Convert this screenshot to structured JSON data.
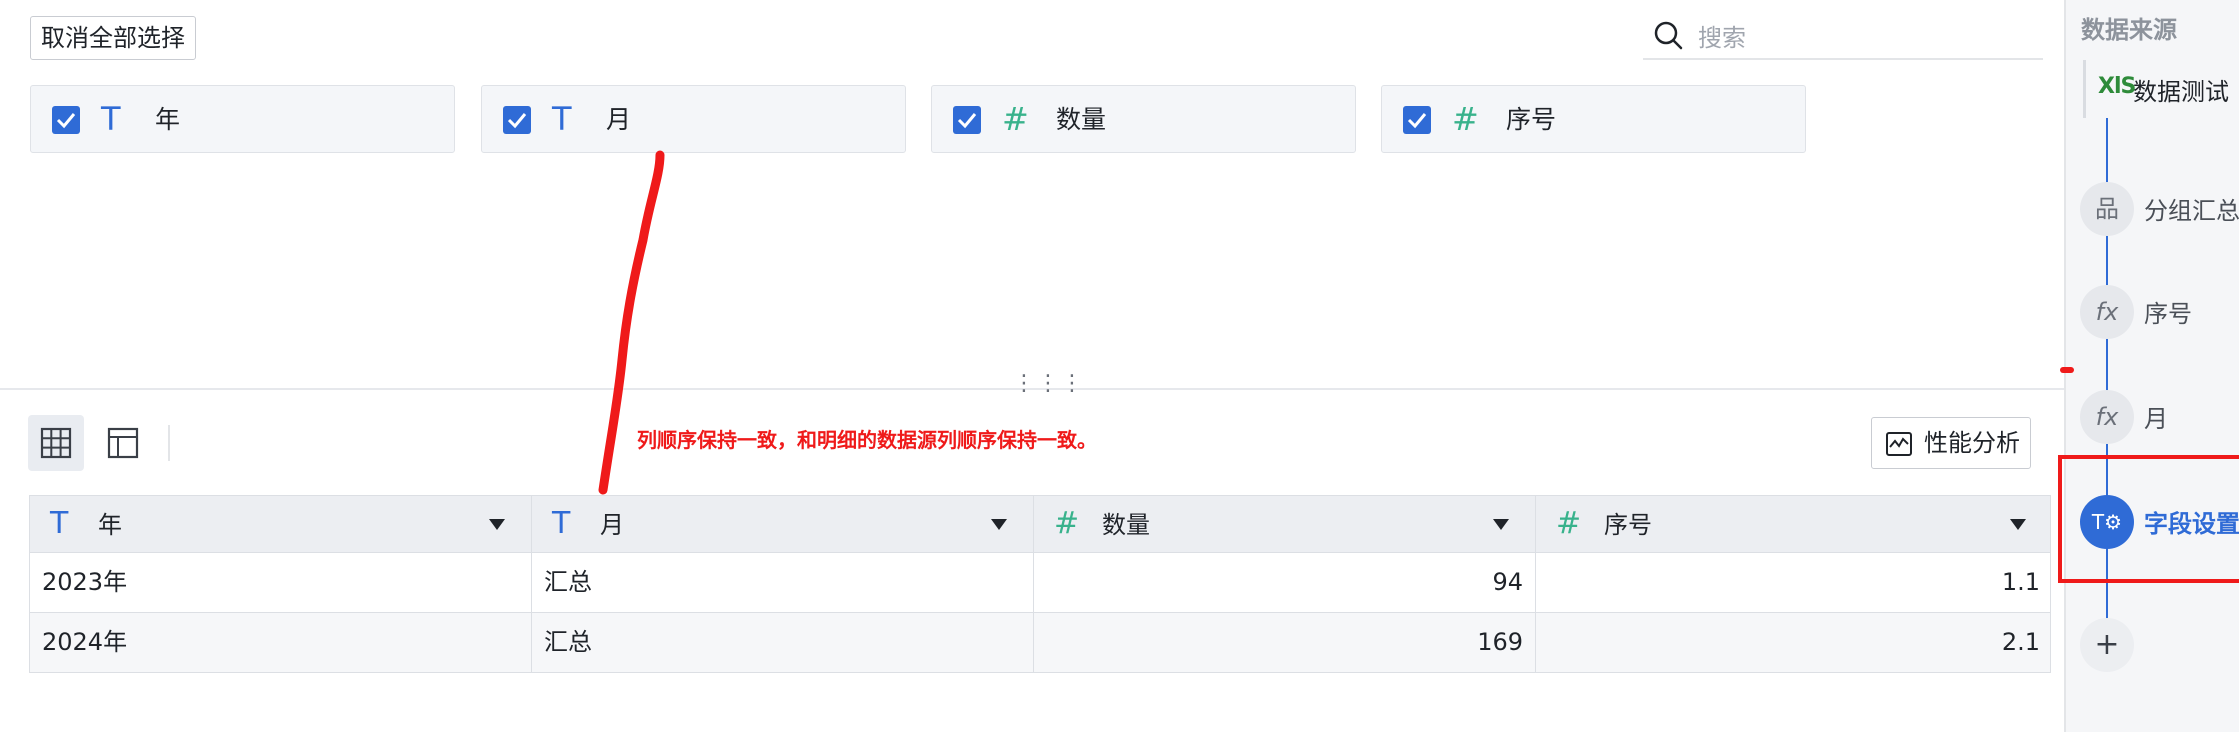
{
  "toolbar": {
    "deselect_all_label": "取消全部选择",
    "search_placeholder": "搜索"
  },
  "field_cards": [
    {
      "type_icon": "T",
      "type": "text",
      "name": "年",
      "checked": true
    },
    {
      "type_icon": "T",
      "type": "text",
      "name": "月",
      "checked": true
    },
    {
      "type_icon": "#",
      "type": "number",
      "name": "数量",
      "checked": true
    },
    {
      "type_icon": "#",
      "type": "number",
      "name": "序号",
      "checked": true
    }
  ],
  "annotation": "列顺序保持一致，和明细的数据源列顺序保持一致。",
  "perf_button_label": "性能分析",
  "table": {
    "headers": [
      {
        "type_icon": "T",
        "name": "年"
      },
      {
        "type_icon": "T",
        "name": "月"
      },
      {
        "type_icon": "#",
        "name": "数量"
      },
      {
        "type_icon": "#",
        "name": "序号"
      }
    ],
    "rows": [
      [
        "2023年",
        "汇总",
        "94",
        "1.1"
      ],
      [
        "2024年",
        "汇总",
        "169",
        "2.1"
      ]
    ]
  },
  "right_panel": {
    "title": "数据来源",
    "source": {
      "badge": "XlS",
      "name": "数据测试"
    },
    "steps": [
      {
        "icon": "品",
        "label": "分组汇总"
      },
      {
        "icon": "fx",
        "label": "序号"
      },
      {
        "icon": "fx",
        "label": "月"
      },
      {
        "icon": "T⚙",
        "label": "字段设置",
        "active": true
      }
    ],
    "add_icon": "+"
  },
  "colors": {
    "accent": "#2f6bd6",
    "number_type": "#38b28c",
    "annotation_red": "#ef1a1a"
  }
}
